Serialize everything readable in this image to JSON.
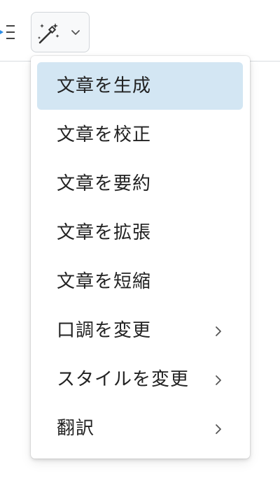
{
  "menu": {
    "items": [
      {
        "label": "文章を生成",
        "has_submenu": false,
        "highlighted": true
      },
      {
        "label": "文章を校正",
        "has_submenu": false,
        "highlighted": false
      },
      {
        "label": "文章を要約",
        "has_submenu": false,
        "highlighted": false
      },
      {
        "label": "文章を拡張",
        "has_submenu": false,
        "highlighted": false
      },
      {
        "label": "文章を短縮",
        "has_submenu": false,
        "highlighted": false
      },
      {
        "label": "口調を変更",
        "has_submenu": true,
        "highlighted": false
      },
      {
        "label": "スタイルを変更",
        "has_submenu": true,
        "highlighted": false
      },
      {
        "label": "翻訳",
        "has_submenu": true,
        "highlighted": false
      }
    ]
  },
  "toolbar": {
    "list_icon": "bulleted-list-icon",
    "ai_button_icon": "magic-wand-icon",
    "dropdown_icon": "chevron-down-icon"
  },
  "colors": {
    "highlight": "#d3e6f3",
    "text": "#222222",
    "border": "#d9dce0",
    "list_accent": "#2d8ee6"
  }
}
